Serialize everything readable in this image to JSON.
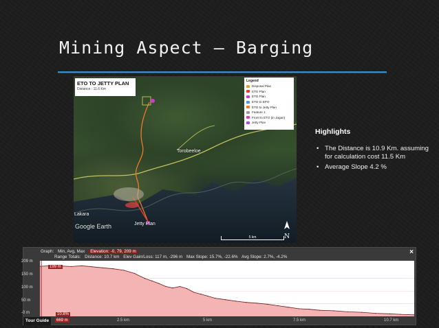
{
  "slide": {
    "title": "Mining Aspect – Barging"
  },
  "map": {
    "title": "ETO TO JETTY PLAN",
    "subtitle": "Distance : 11.6 Km",
    "legend_title": "Legend",
    "legend": [
      {
        "label": "Disposal Plan",
        "color": "#e0a030"
      },
      {
        "label": "ETO Plan",
        "color": "#e33a2a"
      },
      {
        "label": "ETO Plan",
        "color": "#c83cc8"
      },
      {
        "label": "ETO to EPO",
        "color": "#4a9ad8"
      },
      {
        "label": "ETO to Jetty Plan",
        "color": "#f07a2a"
      },
      {
        "label": "Feature 1",
        "color": "#999999"
      },
      {
        "label": "Front to ETO (in Jagan)",
        "color": "#d040c0"
      },
      {
        "label": "Jetty Plan",
        "color": "#a050d8"
      }
    ],
    "labels": {
      "torobeloe": "Torobeeloe",
      "lakara": "Lakara",
      "jetty": "Jetty Plan",
      "google": "Google Earth"
    },
    "scale": "5 km",
    "north": "N"
  },
  "highlights": {
    "title": "Highlights",
    "items": [
      "The Distance is 10.9 Km. assuming for calculation cost 11.5 Km",
      "Average Slope 4.2 %"
    ]
  },
  "elevation": {
    "row1": [
      "Graph:",
      "Min, Avg, Max",
      "Elevation: -0, 79, 209 m"
    ],
    "row2": [
      "Range Totals:",
      "Distance: 10.7 km",
      "Elev Gain/Loss: 117 m, -296 m",
      "Max Slope: 15.7%, -22.6%",
      "Avg Slope: 2.7%, -4.2%"
    ],
    "y_ticks": [
      "209 m",
      "150 m",
      "100 m",
      "50 m",
      "-0 m"
    ],
    "x_ticks": [
      "2.5 km",
      "5 km",
      "7.5 km",
      "10.7 km"
    ],
    "marker_top": "199 m",
    "marker_slope": "10.8%",
    "marker_value": "669 m",
    "tour_guide": "Tour Guide",
    "close": "×"
  },
  "chart_data": {
    "type": "area",
    "title": "",
    "xlabel": "",
    "ylabel": "",
    "xlim": [
      0,
      10.7
    ],
    "ylim": [
      0,
      209
    ],
    "x": [
      0,
      0.3,
      0.6,
      0.9,
      1.2,
      1.5,
      1.8,
      2.1,
      2.4,
      2.7,
      3.0,
      3.2,
      3.4,
      3.6,
      3.8,
      4.0,
      4.2,
      4.4,
      4.6,
      4.8,
      5.0,
      5.3,
      5.6,
      5.9,
      6.2,
      6.5,
      6.8,
      7.1,
      7.4,
      7.7,
      8.0,
      8.4,
      8.8,
      9.2,
      9.6,
      10.0,
      10.3,
      10.7
    ],
    "series": [
      {
        "values": [
          198,
          200,
          199,
          197,
          200,
          196,
          192,
          188,
          182,
          170,
          150,
          140,
          130,
          118,
          112,
          118,
          110,
          95,
          88,
          80,
          72,
          66,
          60,
          55,
          52,
          48,
          42,
          36,
          30,
          28,
          24,
          22,
          18,
          16,
          12,
          10,
          8,
          6
        ]
      }
    ]
  }
}
